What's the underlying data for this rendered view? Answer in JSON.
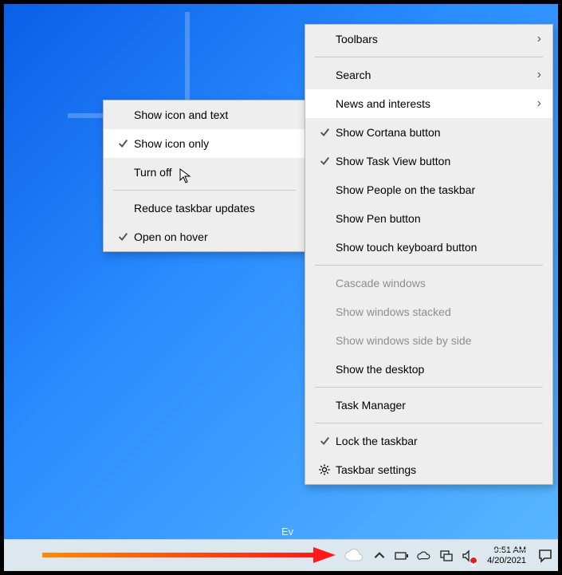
{
  "submenu": {
    "items": [
      {
        "label": "Show icon and text",
        "checked": false,
        "hover": false
      },
      {
        "label": "Show icon only",
        "checked": true,
        "hover": true
      },
      {
        "label": "Turn off",
        "checked": false,
        "hover": false
      }
    ],
    "below": [
      {
        "label": "Reduce taskbar updates",
        "checked": false
      },
      {
        "label": "Open on hover",
        "checked": true
      }
    ]
  },
  "mainmenu": {
    "group1": [
      {
        "label": "Toolbars",
        "arrow": true
      }
    ],
    "group2": [
      {
        "label": "Search",
        "arrow": true
      },
      {
        "label": "News and interests",
        "arrow": true,
        "hover": true
      },
      {
        "label": "Show Cortana button",
        "checked": true
      },
      {
        "label": "Show Task View button",
        "checked": true
      },
      {
        "label": "Show People on the taskbar"
      },
      {
        "label": "Show Pen button"
      },
      {
        "label": "Show touch keyboard button"
      }
    ],
    "group3": [
      {
        "label": "Cascade windows",
        "disabled": true
      },
      {
        "label": "Show windows stacked",
        "disabled": true
      },
      {
        "label": "Show windows side by side",
        "disabled": true
      },
      {
        "label": "Show the desktop"
      }
    ],
    "group4": [
      {
        "label": "Task Manager"
      }
    ],
    "group5": [
      {
        "label": "Lock the taskbar",
        "checked": true
      },
      {
        "label": "Taskbar settings",
        "gear": true
      }
    ]
  },
  "desktop": {
    "partial_text": "Ev"
  },
  "taskbar": {
    "time": "9:51 AM",
    "date": "4/20/2021"
  }
}
